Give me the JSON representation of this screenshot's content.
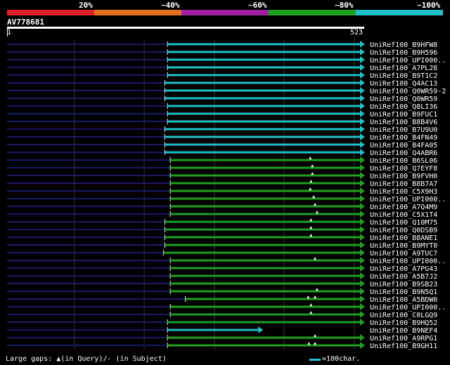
{
  "scale": {
    "labels": [
      "20%",
      "~40%",
      "~60%",
      "~80%",
      "~100%"
    ],
    "colors": [
      "#e0202a",
      "#e07020",
      "#a020a0",
      "#20a020",
      "#20c0c8"
    ]
  },
  "query": {
    "id": "AV778681",
    "start": "1",
    "end": "523"
  },
  "legend": {
    "gaps_text": "Large gaps: ▲(in Query)/- (in Subject)",
    "scale_text": "=100char."
  },
  "chart_data": {
    "type": "alignment-overview",
    "query_length": 523,
    "hits": [
      {
        "name": "UniRef100_B9HFW8",
        "start": 236,
        "end": 523,
        "band": "~100%",
        "gaps": []
      },
      {
        "name": "UniRef100_B9H596",
        "start": 236,
        "end": 523,
        "band": "~100%",
        "gaps": []
      },
      {
        "name": "UniRef100_UPI000..",
        "start": 236,
        "end": 523,
        "band": "~100%",
        "gaps": []
      },
      {
        "name": "UniRef100_A7PL28",
        "start": 236,
        "end": 523,
        "band": "~100%",
        "gaps": []
      },
      {
        "name": "UniRef100_B9T1C2",
        "start": 236,
        "end": 523,
        "band": "~100%",
        "gaps": []
      },
      {
        "name": "UniRef100_Q4AC13",
        "start": 232,
        "end": 523,
        "band": "~100%",
        "gaps": []
      },
      {
        "name": "UniRef100_Q0WR59-2",
        "start": 232,
        "end": 523,
        "band": "~100%",
        "gaps": []
      },
      {
        "name": "UniRef100_Q0WR59",
        "start": 232,
        "end": 523,
        "band": "~100%",
        "gaps": []
      },
      {
        "name": "UniRef100_Q8LI36",
        "start": 236,
        "end": 523,
        "band": "~100%",
        "gaps": []
      },
      {
        "name": "UniRef100_B9FUC1",
        "start": 236,
        "end": 523,
        "band": "~100%",
        "gaps": []
      },
      {
        "name": "UniRef100_B8B4V6",
        "start": 236,
        "end": 523,
        "band": "~100%",
        "gaps": []
      },
      {
        "name": "UniRef100_B7U9U0",
        "start": 232,
        "end": 523,
        "band": "~100%",
        "gaps": []
      },
      {
        "name": "UniRef100_B4FN49",
        "start": 232,
        "end": 523,
        "band": "~100%",
        "gaps": []
      },
      {
        "name": "UniRef100_B4FA05",
        "start": 232,
        "end": 523,
        "band": "~100%",
        "gaps": []
      },
      {
        "name": "UniRef100_Q4ABR6",
        "start": 232,
        "end": 523,
        "band": "~100%",
        "gaps": []
      },
      {
        "name": "UniRef100_B6SL06",
        "start": 240,
        "end": 523,
        "band": "~80%",
        "gaps": [
          445
        ]
      },
      {
        "name": "UniRef100_Q7EYF8",
        "start": 240,
        "end": 523,
        "band": "~80%",
        "gaps": [
          448
        ]
      },
      {
        "name": "UniRef100_B9FVH0",
        "start": 240,
        "end": 523,
        "band": "~80%",
        "gaps": [
          448
        ]
      },
      {
        "name": "UniRef100_B8B7A7",
        "start": 240,
        "end": 523,
        "band": "~80%",
        "gaps": [
          446
        ]
      },
      {
        "name": "UniRef100_C5X9H3",
        "start": 240,
        "end": 523,
        "band": "~80%",
        "gaps": [
          445
        ]
      },
      {
        "name": "UniRef100_UPI000..",
        "start": 240,
        "end": 523,
        "band": "~80%",
        "gaps": [
          450
        ]
      },
      {
        "name": "UniRef100_A7Q4M9",
        "start": 240,
        "end": 523,
        "band": "~80%",
        "gaps": [
          452
        ]
      },
      {
        "name": "UniRef100_C5X1T4",
        "start": 240,
        "end": 523,
        "band": "~80%",
        "gaps": [
          455
        ]
      },
      {
        "name": "UniRef100_Q10M75",
        "start": 232,
        "end": 523,
        "band": "~80%",
        "gaps": [
          446
        ]
      },
      {
        "name": "UniRef100_Q0DSB9",
        "start": 232,
        "end": 523,
        "band": "~80%",
        "gaps": [
          446
        ]
      },
      {
        "name": "UniRef100_B8ANE1",
        "start": 232,
        "end": 523,
        "band": "~80%",
        "gaps": [
          446
        ]
      },
      {
        "name": "UniRef100_B9MYT0",
        "start": 232,
        "end": 523,
        "band": "~80%",
        "gaps": []
      },
      {
        "name": "UniRef100_A9TUC7",
        "start": 230,
        "end": 523,
        "band": "~80%",
        "gaps": []
      },
      {
        "name": "UniRef100_UPI000..",
        "start": 240,
        "end": 523,
        "band": "~80%",
        "gaps": [
          452
        ]
      },
      {
        "name": "UniRef100_A7PG43",
        "start": 240,
        "end": 523,
        "band": "~80%",
        "gaps": []
      },
      {
        "name": "UniRef100_A5B7J2",
        "start": 240,
        "end": 523,
        "band": "~80%",
        "gaps": []
      },
      {
        "name": "UniRef100_B9SB23",
        "start": 240,
        "end": 523,
        "band": "~80%",
        "gaps": []
      },
      {
        "name": "UniRef100_B9N5Q1",
        "start": 240,
        "end": 523,
        "band": "~80%",
        "gaps": [
          455
        ]
      },
      {
        "name": "UniRef100_A5BDW0",
        "start": 262,
        "end": 523,
        "band": "~80%",
        "gaps": [
          442,
          452
        ]
      },
      {
        "name": "UniRef100_UPI000..",
        "start": 240,
        "end": 523,
        "band": "~80%",
        "gaps": [
          446
        ]
      },
      {
        "name": "UniRef100_C0LGQ9",
        "start": 240,
        "end": 523,
        "band": "~80%",
        "gaps": [
          446
        ]
      },
      {
        "name": "UniRef100_B9HQ52",
        "start": 236,
        "end": 523,
        "band": "~80%",
        "gaps": []
      },
      {
        "name": "UniRef100_B9NEF4",
        "start": 236,
        "end": 374,
        "band": "~100%",
        "gaps": []
      },
      {
        "name": "UniRef100_A9RPG1",
        "start": 236,
        "end": 523,
        "band": "~80%",
        "gaps": [
          452
        ]
      },
      {
        "name": "UniRef100_B9GH11",
        "start": 236,
        "end": 523,
        "band": "~80%",
        "gaps": [
          443,
          452
        ]
      }
    ]
  }
}
